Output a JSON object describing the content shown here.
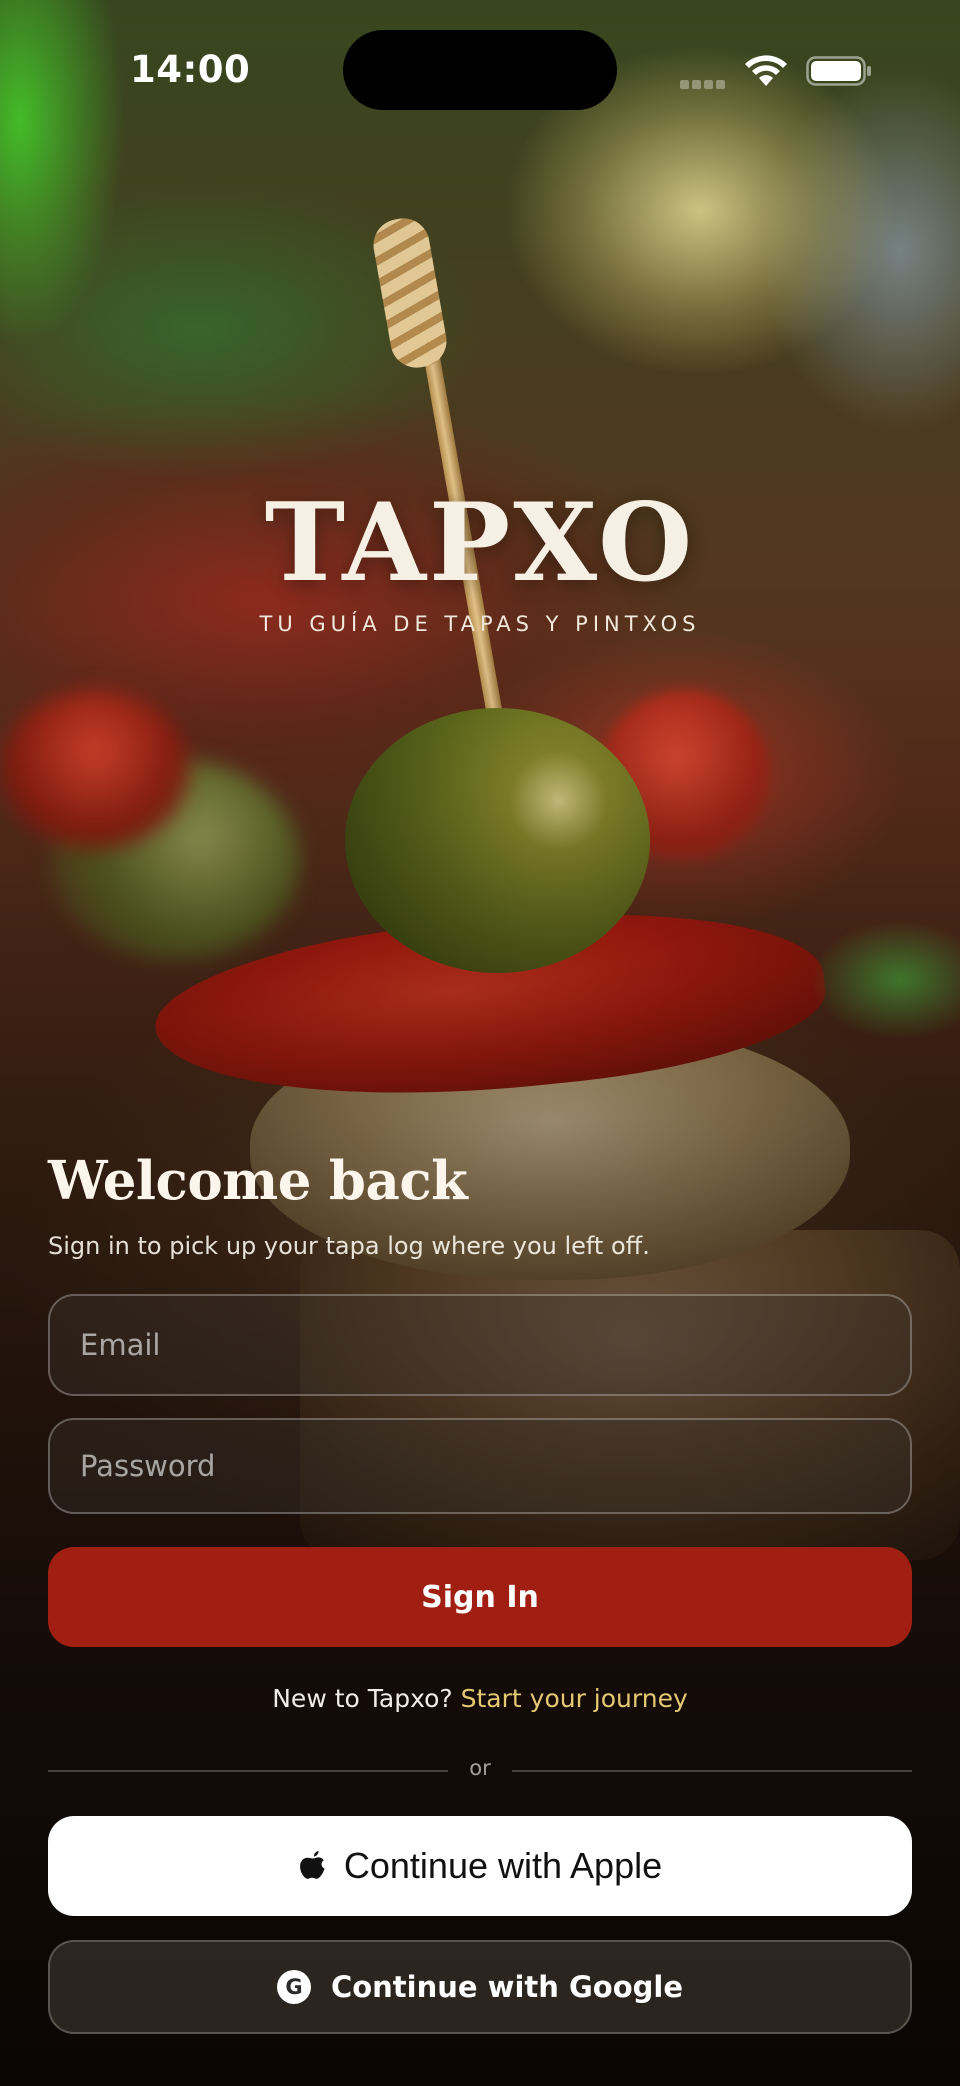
{
  "status_bar": {
    "time": "14:00",
    "icons": [
      "cellular-signal-icon",
      "wifi-icon",
      "battery-icon"
    ]
  },
  "brand": {
    "name": "TAPXO",
    "tagline": "TU GUÍA DE TAPAS Y PINTXOS"
  },
  "login": {
    "heading": "Welcome back",
    "subtitle": "Sign in to pick up your tapa log where you left off.",
    "email_placeholder": "Email",
    "password_placeholder": "Password",
    "sign_in_label": "Sign In",
    "signup_prompt": "New to Tapxo?",
    "signup_link": "Start your journey",
    "divider": "or",
    "apple_label": "Continue with Apple",
    "google_label": "Continue with Google",
    "google_badge": "G"
  },
  "colors": {
    "primary_button": "#a01f12",
    "link": "#e4c873",
    "apple_button": "#ffffff"
  }
}
